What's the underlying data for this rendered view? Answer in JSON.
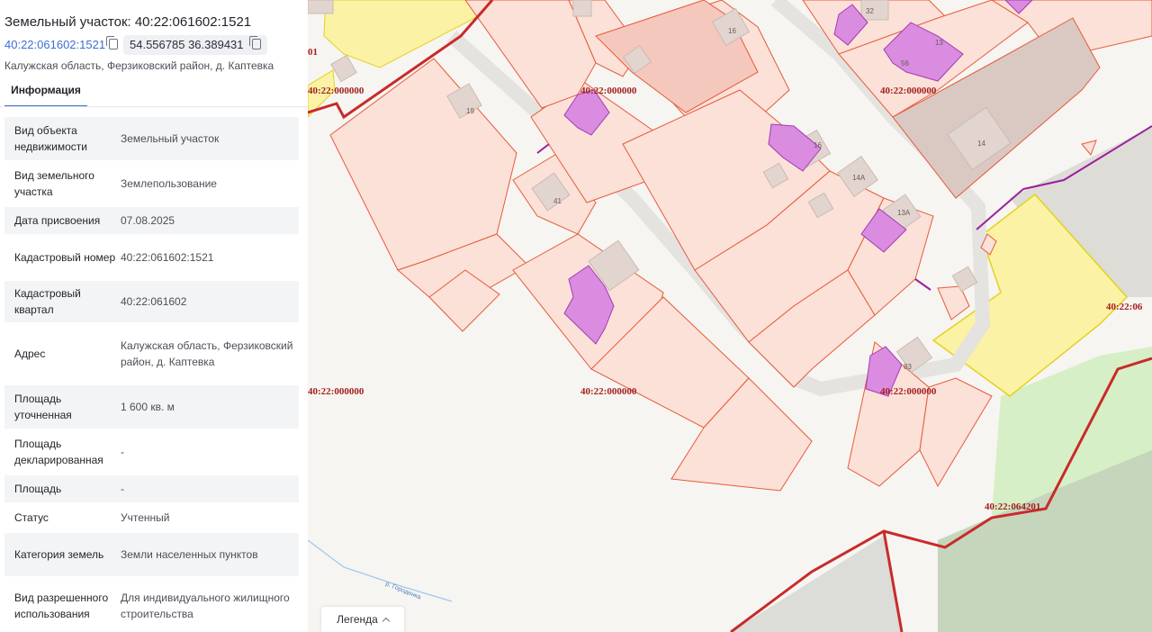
{
  "panel": {
    "title": "Земельный участок: 40:22:061602:1521",
    "cad_link": "40:22:061602:1521",
    "coords": "54.556785 36.389431",
    "address_short": "Калужская область, Ферзиковский район, д. Каптевка",
    "tab_info": "Информация",
    "rows": [
      {
        "k": "Вид объекта недвижимости",
        "v": "Земельный участок"
      },
      {
        "k": "Вид земельного участка",
        "v": "Землепользование"
      },
      {
        "k": "Дата присвоения",
        "v": "07.08.2025"
      },
      {
        "k": "Кадастровый номер",
        "v": "40:22:061602:1521"
      },
      {
        "k": "Кадастровый квартал",
        "v": "40:22:061602"
      },
      {
        "k": "Адрес",
        "v": "Калужская область, Ферзиковский район, д. Каптевка"
      },
      {
        "k": "Площадь уточненная",
        "v": "1 600 кв. м"
      },
      {
        "k": "Площадь декларированная",
        "v": "-"
      },
      {
        "k": "Площадь",
        "v": "-"
      },
      {
        "k": "Статус",
        "v": "Учтенный"
      },
      {
        "k": "Категория земель",
        "v": "Земли населенных пунктов"
      },
      {
        "k": "Вид разрешенного использования",
        "v": "Для индивидуального жилищного строительства"
      }
    ]
  },
  "map": {
    "labels": {
      "q1": "40:22:000000",
      "q2": "40:22:000000",
      "q3": "40:22:000000",
      "q4": "40:22:000000",
      "q5": "40:22:000000",
      "q6": "40:22:000000",
      "q7": "40:22:064201",
      "q8": "40:22:06",
      "q9": "01"
    },
    "house_numbers": [
      "19",
      "41",
      "16",
      "16",
      "14А",
      "13А",
      "14",
      "32",
      "13",
      "56",
      "83"
    ],
    "river": "р. Городенка",
    "legend_label": "Легенда",
    "colors": {
      "parcel_fill": "#fbe1d8",
      "parcel_stroke": "#e8593a",
      "building": "#d98ce0",
      "yellow": "#fbf2a6",
      "quarter_line": "#c92a2a"
    }
  }
}
